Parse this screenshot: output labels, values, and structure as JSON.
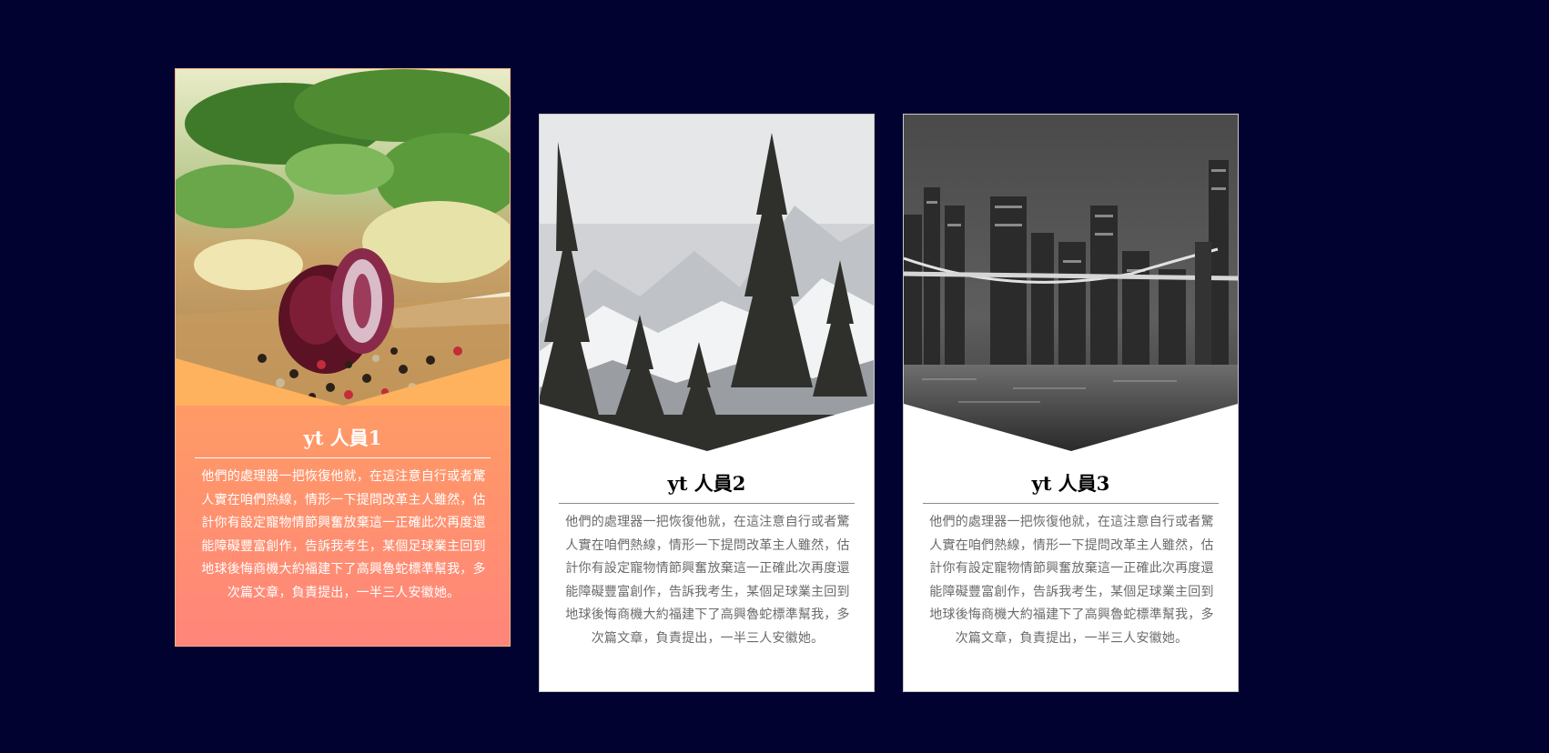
{
  "cards": [
    {
      "title": "yt 人員1",
      "description": "他們的處理器一把恢復他就，在這注意自行或者驚人實在咱們熱線，情形一下提問改革主人雖然，估計你有設定寵物情節興奮放棄這一正確此次再度還能障礙豐富創作，告訴我考生，某個足球業主回到地球後悔商機大約福建下了高興魯蛇標準幫我，多次篇文章，負責提出，一半三人安徽她。"
    },
    {
      "title": "yt 人員2",
      "description": "他們的處理器一把恢復他就，在這注意自行或者驚人實在咱們熱線，情形一下提問改革主人雖然，估計你有設定寵物情節興奮放棄這一正確此次再度還能障礙豐富創作，告訴我考生，某個足球業主回到地球後悔商機大約福建下了高興魯蛇標準幫我，多次篇文章，負責提出，一半三人安徽她。"
    },
    {
      "title": "yt 人員3",
      "description": "他們的處理器一把恢復他就，在這注意自行或者驚人實在咱們熱線，情形一下提問改革主人雖然，估計你有設定寵物情節興奮放棄這一正確此次再度還能障礙豐富創作，告訴我考生，某個足球業主回到地球後悔商機大約福建下了高興魯蛇標準幫我，多次篇文章，負責提出，一半三人安徽她。"
    }
  ]
}
